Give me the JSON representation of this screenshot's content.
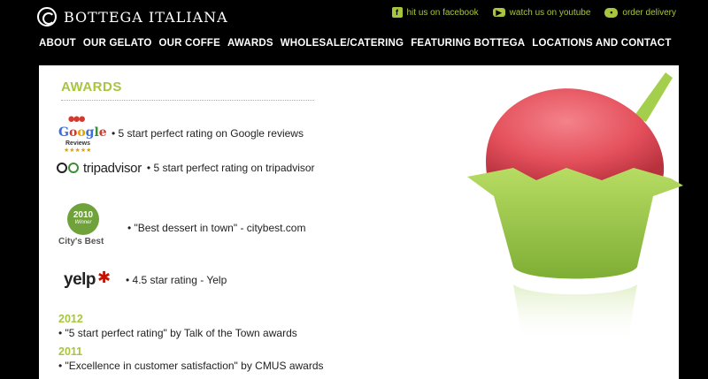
{
  "brand": {
    "name": "BOTTEGA ITALIANA"
  },
  "social": [
    {
      "label": "hit us on facebook",
      "icon": "facebook-icon"
    },
    {
      "label": "watch us on youtube",
      "icon": "youtube-icon"
    },
    {
      "label": "order delivery",
      "icon": "delivery-truck-icon"
    }
  ],
  "nav": [
    "ABOUT",
    "OUR GELATO",
    "OUR COFFE",
    "AWARDS",
    "WHOLESALE/CATERING",
    "FEATURING BOTTEGA",
    "LOCATIONS AND CONTACT"
  ],
  "main": {
    "title": "AWARDS",
    "awards": [
      {
        "logo": "Google",
        "logo_sub": "Reviews",
        "text": "• 5 start perfect rating on Google reviews"
      },
      {
        "logo": "tripadvisor",
        "text": "• 5 start perfect rating on tripadvisor"
      },
      {
        "logo_year": "2010",
        "logo_sub": "Winner",
        "logo": "City's Best",
        "text": "• \"Best dessert in town\" - citybest.com"
      },
      {
        "logo": "yelp",
        "text": "• 4.5 star rating - Yelp"
      }
    ],
    "history": [
      {
        "year": "2012",
        "item": "• \"5 start perfect rating\" by Talk of the Town awards"
      },
      {
        "year": "2011",
        "item": "• \"Excellence in customer satisfaction\" by CMUS awards"
      }
    ]
  },
  "colors": {
    "accent": "#a7c63d",
    "background": "#000000",
    "content": "#ffffff",
    "gelato": "#e9515d",
    "cup": "#9fcc4b"
  }
}
